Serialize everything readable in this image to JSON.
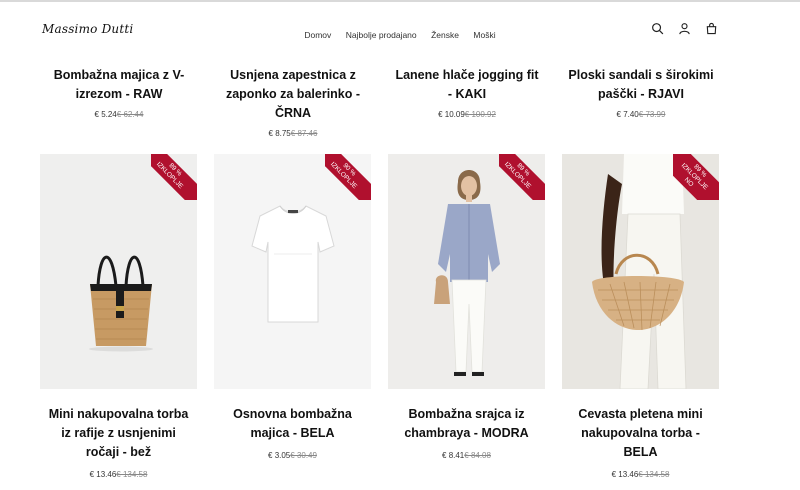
{
  "brand": {
    "logo_text": "Massimo Dutti"
  },
  "nav": [
    "Domov",
    "Najbolje prodajano",
    "Ženske",
    "Moški"
  ],
  "header_icons": [
    "search-icon",
    "user-icon",
    "bag-icon"
  ],
  "previous_row": [
    {
      "title": "Bombažna majica z V-izrezom - RAW",
      "price": "€ 5.24",
      "old_price": "€ 62.44"
    },
    {
      "title": "Usnjena zapestnica z zaponko za balerinko - ČRNA",
      "price": "€ 8.75",
      "old_price": "€ 87.46"
    },
    {
      "title": "Lanene hlače jogging fit - KAKI",
      "price": "€ 10.09",
      "old_price": "€ 100.92"
    },
    {
      "title": "Ploski sandali s širokimi paščki - RJAVI",
      "price": "€ 7.40",
      "old_price": "€ 73.99"
    }
  ],
  "products": [
    {
      "title": "Mini nakupovalna torba iz rafije z usnjenimi ročaji - bež",
      "price": "€ 13.46",
      "old_price": "€ 134.58",
      "badge_pct": "89 %",
      "badge_text": "IZKLOPLJE",
      "badge_extra": "",
      "image": "raffia-tote-bag"
    },
    {
      "title": "Osnovna bombažna majica - BELA",
      "price": "€ 3.05",
      "old_price": "€ 30.49",
      "badge_pct": "90 %",
      "badge_text": "IZKLOPLJE",
      "badge_extra": "",
      "image": "white-tshirt"
    },
    {
      "title": "Bombažna srajca iz chambraya - MODRA",
      "price": "€ 8.41",
      "old_price": "€ 84.08",
      "badge_pct": "89 %",
      "badge_text": "IZKLOPLJE",
      "badge_extra": "",
      "image": "model-blue-shirt"
    },
    {
      "title": "Cevasta pletena mini nakupovalna torba - BELA",
      "price": "€ 13.46",
      "old_price": "€ 134.58",
      "badge_pct": "89 %",
      "badge_text": "IZKLOPLJE",
      "badge_extra": "NO",
      "image": "woven-bag-model"
    }
  ],
  "colors": {
    "badge": "#b0102e",
    "text": "#111111",
    "old_price": "#888888"
  }
}
